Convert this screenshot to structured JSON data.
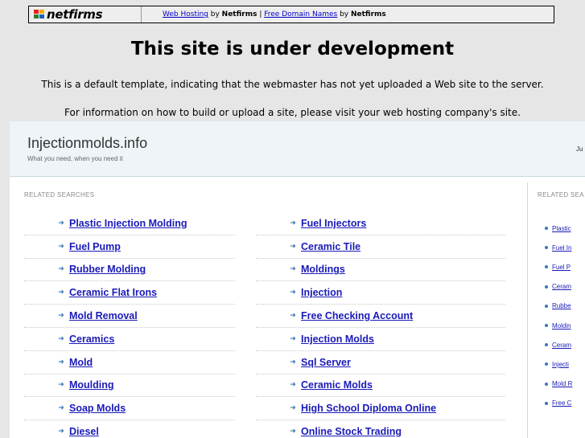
{
  "banner": {
    "logo_text": "netfirms",
    "link1": "Web Hosting",
    "by1": " by ",
    "brand1": "Netfirms",
    "sep": " | ",
    "link2": "Free Domain Names",
    "by2": " by ",
    "brand2": "Netfirms",
    "logo_colors": [
      "#e2231a",
      "#f7a800",
      "#2e7d32",
      "#1565c0"
    ]
  },
  "dev": {
    "title": "This site is under development",
    "line1": "This is a default template, indicating that the webmaster has not yet uploaded a Web site to the server.",
    "line2": "For information on how to build or upload a site, please visit your web hosting company's site."
  },
  "parked": {
    "site_name": "Injectionmolds.info",
    "tagline": "What you need, when you need it",
    "header_right": "Ju",
    "related_label": "RELATED SEARCHES",
    "related_label_right": "RELATED SEA",
    "col1": [
      "Plastic Injection Molding",
      "Fuel Pump",
      "Rubber Molding",
      "Ceramic Flat Irons",
      "Mold Removal",
      "Ceramics",
      "Mold",
      "Moulding",
      "Soap Molds",
      "Diesel"
    ],
    "col2": [
      "Fuel Injectors",
      "Ceramic Tile",
      "Moldings",
      "Injection",
      "Free Checking Account",
      "Injection Molds",
      "Sql Server",
      "Ceramic Molds",
      "High School Diploma Online",
      "Online Stock Trading"
    ],
    "side": [
      "Plastic",
      "Fuel In",
      "Fuel P",
      "Ceram",
      "Rubbe",
      "Moldin",
      "Ceram",
      "Injecti",
      "Mold R",
      "Free C"
    ]
  }
}
